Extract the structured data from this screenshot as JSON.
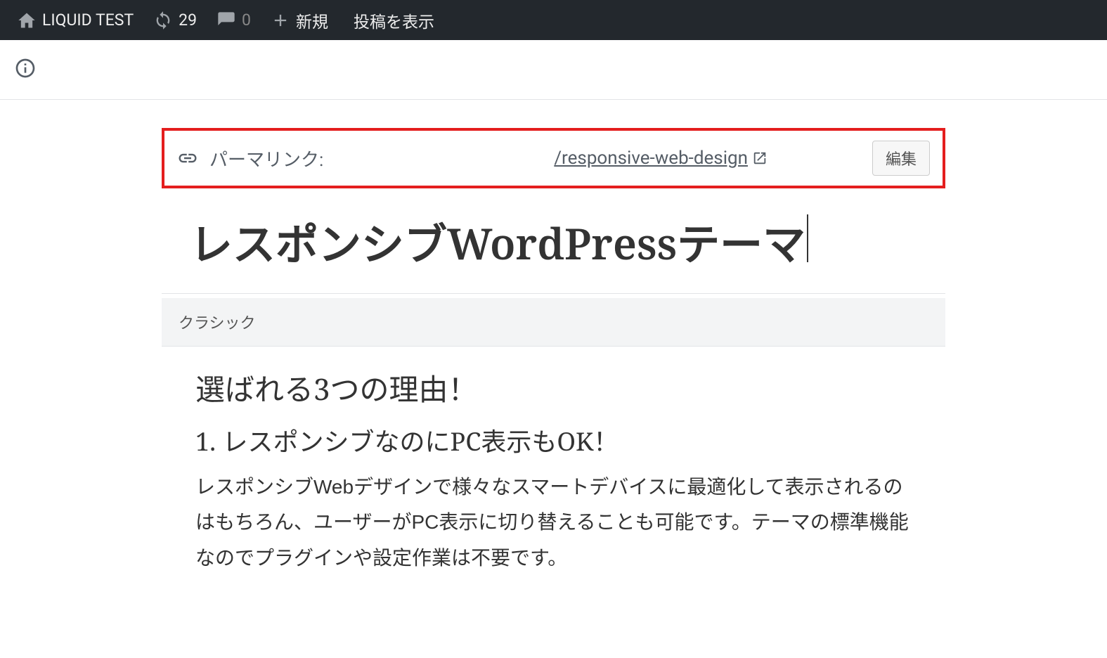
{
  "admin_bar": {
    "site_name": "LIQUID TEST",
    "updates_count": "29",
    "comments_count": "0",
    "new_label": "新規",
    "view_post_label": "投稿を表示"
  },
  "permalink": {
    "label": "パーマリンク:",
    "slug": "/responsive-web-design",
    "edit_button": "編集"
  },
  "post": {
    "title": "レスポンシブWordPressテーマ"
  },
  "block": {
    "label": "クラシック"
  },
  "content": {
    "heading1": "選ばれる3つの理由！",
    "heading2": "1. レスポンシブなのにPC表示もOK！",
    "paragraph": "レスポンシブWebデザインで様々なスマートデバイスに最適化して表示されるのはもちろん、ユーザーがPC表示に切り替えることも可能です。テーマの標準機能なのでプラグインや設定作業は不要です。"
  }
}
